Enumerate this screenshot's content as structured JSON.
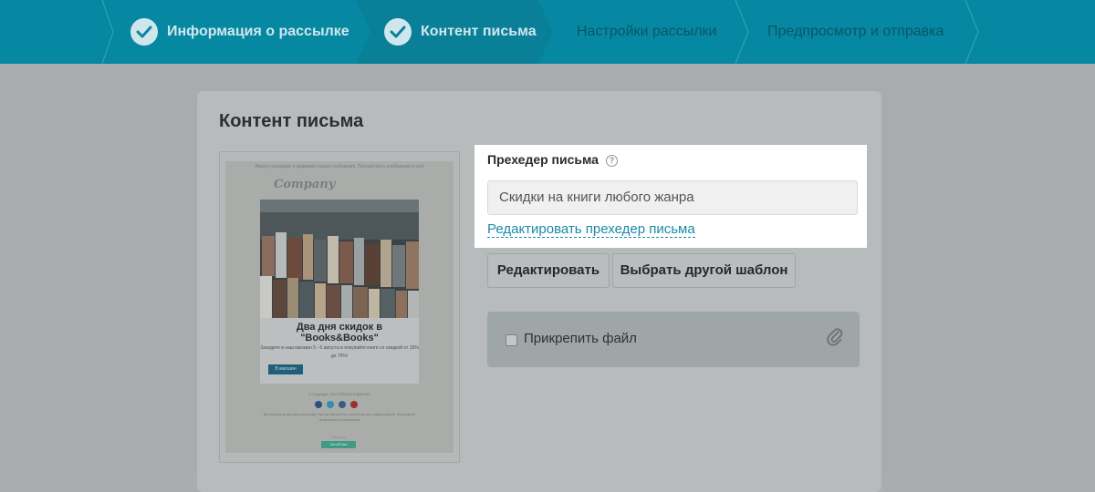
{
  "stepper": {
    "steps": [
      {
        "label": "Информация о рассылке",
        "state": "done"
      },
      {
        "label": "Контент письма",
        "state": "done"
      },
      {
        "label": "Настройки рассылки",
        "state": "todo"
      },
      {
        "label": "Предпросмотр и отправка",
        "state": "todo"
      }
    ]
  },
  "content": {
    "title": "Контент письма"
  },
  "thumbnail": {
    "top_text": "Вверху прехедер и видимой строки сообщения. Просмотреть сообщение в web",
    "logo": "Company",
    "heading": "Два дня скидок в \"Books&Books\"",
    "subtext": "Заходите в наш магазин 5 - 6 августа и покупайте книги со скидкой от 15% до 75%!",
    "button": "В магазин",
    "footer": "© Copyright, 2015 ЯРКОЕ ИЗДАНИЕ",
    "footer2": "Вы получили данную рассылку, так как являетесь клиентом или подписчиком. Вы можете отписаться от рассылки",
    "badge_label": "Powered by",
    "badge": "SendPulse"
  },
  "preheader": {
    "label": "Прехедер письма",
    "help_icon": "?",
    "value": "Скидки на книги любого жанра",
    "edit_link": "Редактировать прехедер письма"
  },
  "actions": {
    "edit": "Редактировать",
    "change_template": "Выбрать другой шаблон"
  },
  "attach": {
    "label": "Прикрепить файл"
  }
}
